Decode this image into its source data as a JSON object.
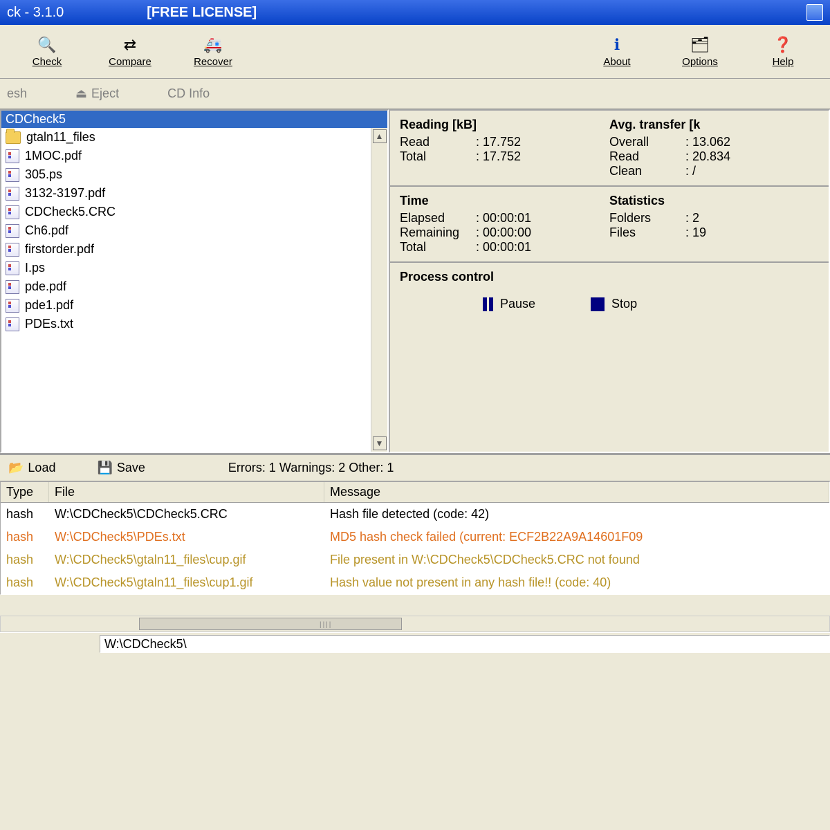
{
  "title": {
    "app": "ck - 3.1.0",
    "license": "[FREE LICENSE]"
  },
  "toolbar": {
    "check": "Check",
    "compare": "Compare",
    "recover": "Recover",
    "about": "About",
    "options": "Options",
    "help": "Help"
  },
  "toolbar2": {
    "refresh": "esh",
    "eject": "Eject",
    "cdinfo": "CD Info"
  },
  "filelist": {
    "selected": "CDCheck5",
    "items": [
      {
        "name": "gtaln11_files",
        "folder": true
      },
      {
        "name": "1MOC.pdf"
      },
      {
        "name": "305.ps"
      },
      {
        "name": "3132-3197.pdf"
      },
      {
        "name": "CDCheck5.CRC"
      },
      {
        "name": "Ch6.pdf"
      },
      {
        "name": "firstorder.pdf"
      },
      {
        "name": "I.ps"
      },
      {
        "name": "pde.pdf"
      },
      {
        "name": "pde1.pdf"
      },
      {
        "name": "PDEs.txt"
      }
    ]
  },
  "reading": {
    "hdr": "Reading [kB]",
    "read_k": "Read",
    "read_v": ": 17.752",
    "total_k": "Total",
    "total_v": ": 17.752"
  },
  "transfer": {
    "hdr": "Avg. transfer [k",
    "overall_k": "Overall",
    "overall_v": ": 13.062",
    "read_k": "Read",
    "read_v": ": 20.834",
    "clean_k": "Clean",
    "clean_v": ": /"
  },
  "time": {
    "hdr": "Time",
    "elapsed_k": "Elapsed",
    "elapsed_v": ": 00:00:01",
    "remaining_k": "Remaining",
    "remaining_v": ": 00:00:00",
    "total_k": "Total",
    "total_v": ": 00:00:01"
  },
  "stats": {
    "hdr": "Statistics",
    "folders_k": "Folders",
    "folders_v": ": 2",
    "files_k": "Files",
    "files_v": ": 19"
  },
  "process": {
    "hdr": "Process control",
    "pause": "Pause",
    "stop": "Stop"
  },
  "logbar": {
    "load": "Load",
    "save": "Save",
    "summary": "Errors: 1 Warnings: 2 Other: 1"
  },
  "logtable": {
    "h_type": "Type",
    "h_file": "File",
    "h_msg": "Message",
    "rows": [
      {
        "type": "hash",
        "file": "W:\\CDCheck5\\CDCheck5.CRC",
        "msg": "Hash file detected (code: 42)",
        "cls": "c-black"
      },
      {
        "type": "hash",
        "file": "W:\\CDCheck5\\PDEs.txt",
        "msg": "MD5 hash check failed (current: ECF2B22A9A14601F09",
        "cls": "c-orange"
      },
      {
        "type": "hash",
        "file": "W:\\CDCheck5\\gtaln11_files\\cup.gif",
        "msg": "File present in W:\\CDCheck5\\CDCheck5.CRC not found",
        "cls": "c-olive"
      },
      {
        "type": "hash",
        "file": "W:\\CDCheck5\\gtaln11_files\\cup1.gif",
        "msg": "Hash value not present in any hash file!! (code: 40)",
        "cls": "c-olive"
      }
    ]
  },
  "statusbar": {
    "path": "W:\\CDCheck5\\"
  }
}
